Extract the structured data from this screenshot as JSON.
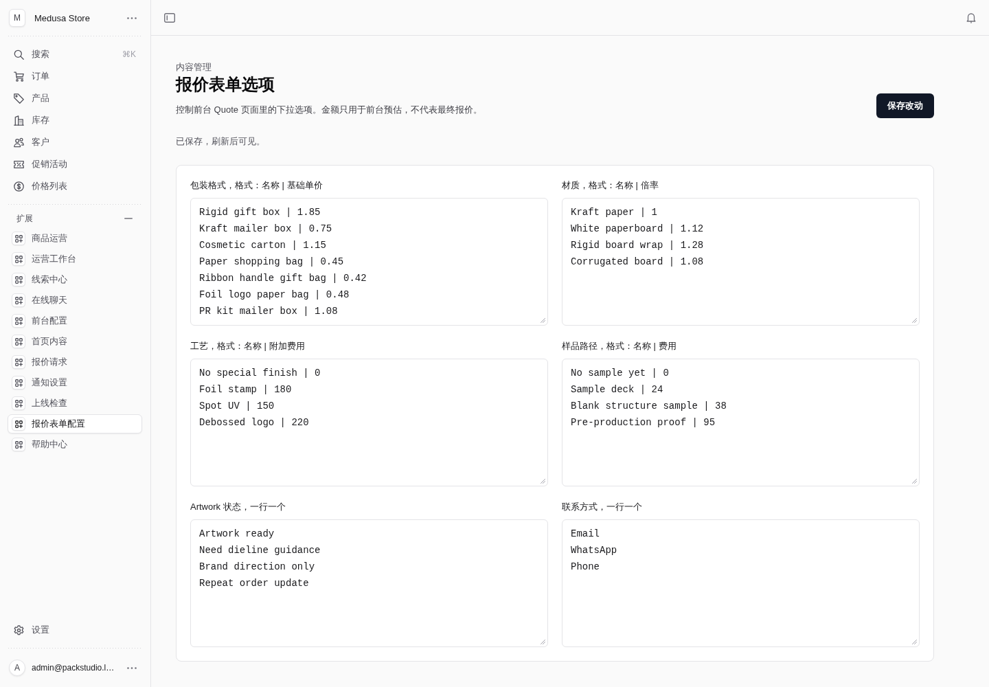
{
  "sidebar": {
    "store": {
      "initial": "M",
      "name": "Medusa Store"
    },
    "main_items": [
      {
        "label": "搜索",
        "shortcut": "⌘K",
        "selected": false
      },
      {
        "label": "订单",
        "selected": false
      },
      {
        "label": "产品",
        "selected": false
      },
      {
        "label": "库存",
        "selected": false
      },
      {
        "label": "客户",
        "selected": false
      },
      {
        "label": "促销活动",
        "selected": false
      },
      {
        "label": "价格列表",
        "selected": false
      }
    ],
    "extensions": {
      "title": "扩展",
      "expanded": true,
      "items": [
        {
          "label": "商品运营",
          "selected": false
        },
        {
          "label": "运营工作台",
          "selected": false
        },
        {
          "label": "线索中心",
          "selected": false
        },
        {
          "label": "在线聊天",
          "selected": false
        },
        {
          "label": "前台配置",
          "selected": false
        },
        {
          "label": "首页内容",
          "selected": false
        },
        {
          "label": "报价请求",
          "selected": false
        },
        {
          "label": "通知设置",
          "selected": false
        },
        {
          "label": "上线检查",
          "selected": false
        },
        {
          "label": "报价表单配置",
          "selected": true
        },
        {
          "label": "帮助中心",
          "selected": false
        }
      ]
    },
    "settings": {
      "label": "设置"
    },
    "user": {
      "initial": "A",
      "email": "admin@packstudio.l…"
    }
  },
  "page": {
    "breadcrumb": "内容管理",
    "title": "报价表单选项",
    "description": "控制前台 Quote 页面里的下拉选项。金额只用于前台预估，不代表最终报价。",
    "save_button": "保存改动",
    "status": "已保存，刷新后可见。"
  },
  "fields": [
    {
      "label": "包装格式，格式：名称 | 基础单价",
      "lines": [
        "Rigid gift box | 1.85",
        "Kraft mailer box | 0.75",
        "Cosmetic carton | 1.15",
        "Paper shopping bag | 0.45",
        "Ribbon handle gift bag | 0.42",
        "Foil logo paper bag | 0.48",
        "PR kit mailer box | 1.08"
      ]
    },
    {
      "label": "材质，格式：名称 | 倍率",
      "lines": [
        "Kraft paper | 1",
        "White paperboard | 1.12",
        "Rigid board wrap | 1.28",
        "Corrugated board | 1.08"
      ]
    },
    {
      "label": "工艺，格式：名称 | 附加费用",
      "lines": [
        "No special finish | 0",
        "Foil stamp | 180",
        "Spot UV | 150",
        "Debossed logo | 220"
      ]
    },
    {
      "label": "样品路径，格式：名称 | 费用",
      "lines": [
        "No sample yet | 0",
        "Sample deck | 24",
        "Blank structure sample | 38",
        "Pre-production proof | 95"
      ]
    },
    {
      "label": "Artwork 状态，一行一个",
      "lines": [
        "Artwork ready",
        "Need dieline guidance",
        "Brand direction only",
        "Repeat order update"
      ]
    },
    {
      "label": "联系方式，一行一个",
      "lines": [
        "Email",
        "WhatsApp",
        "Phone"
      ]
    }
  ]
}
